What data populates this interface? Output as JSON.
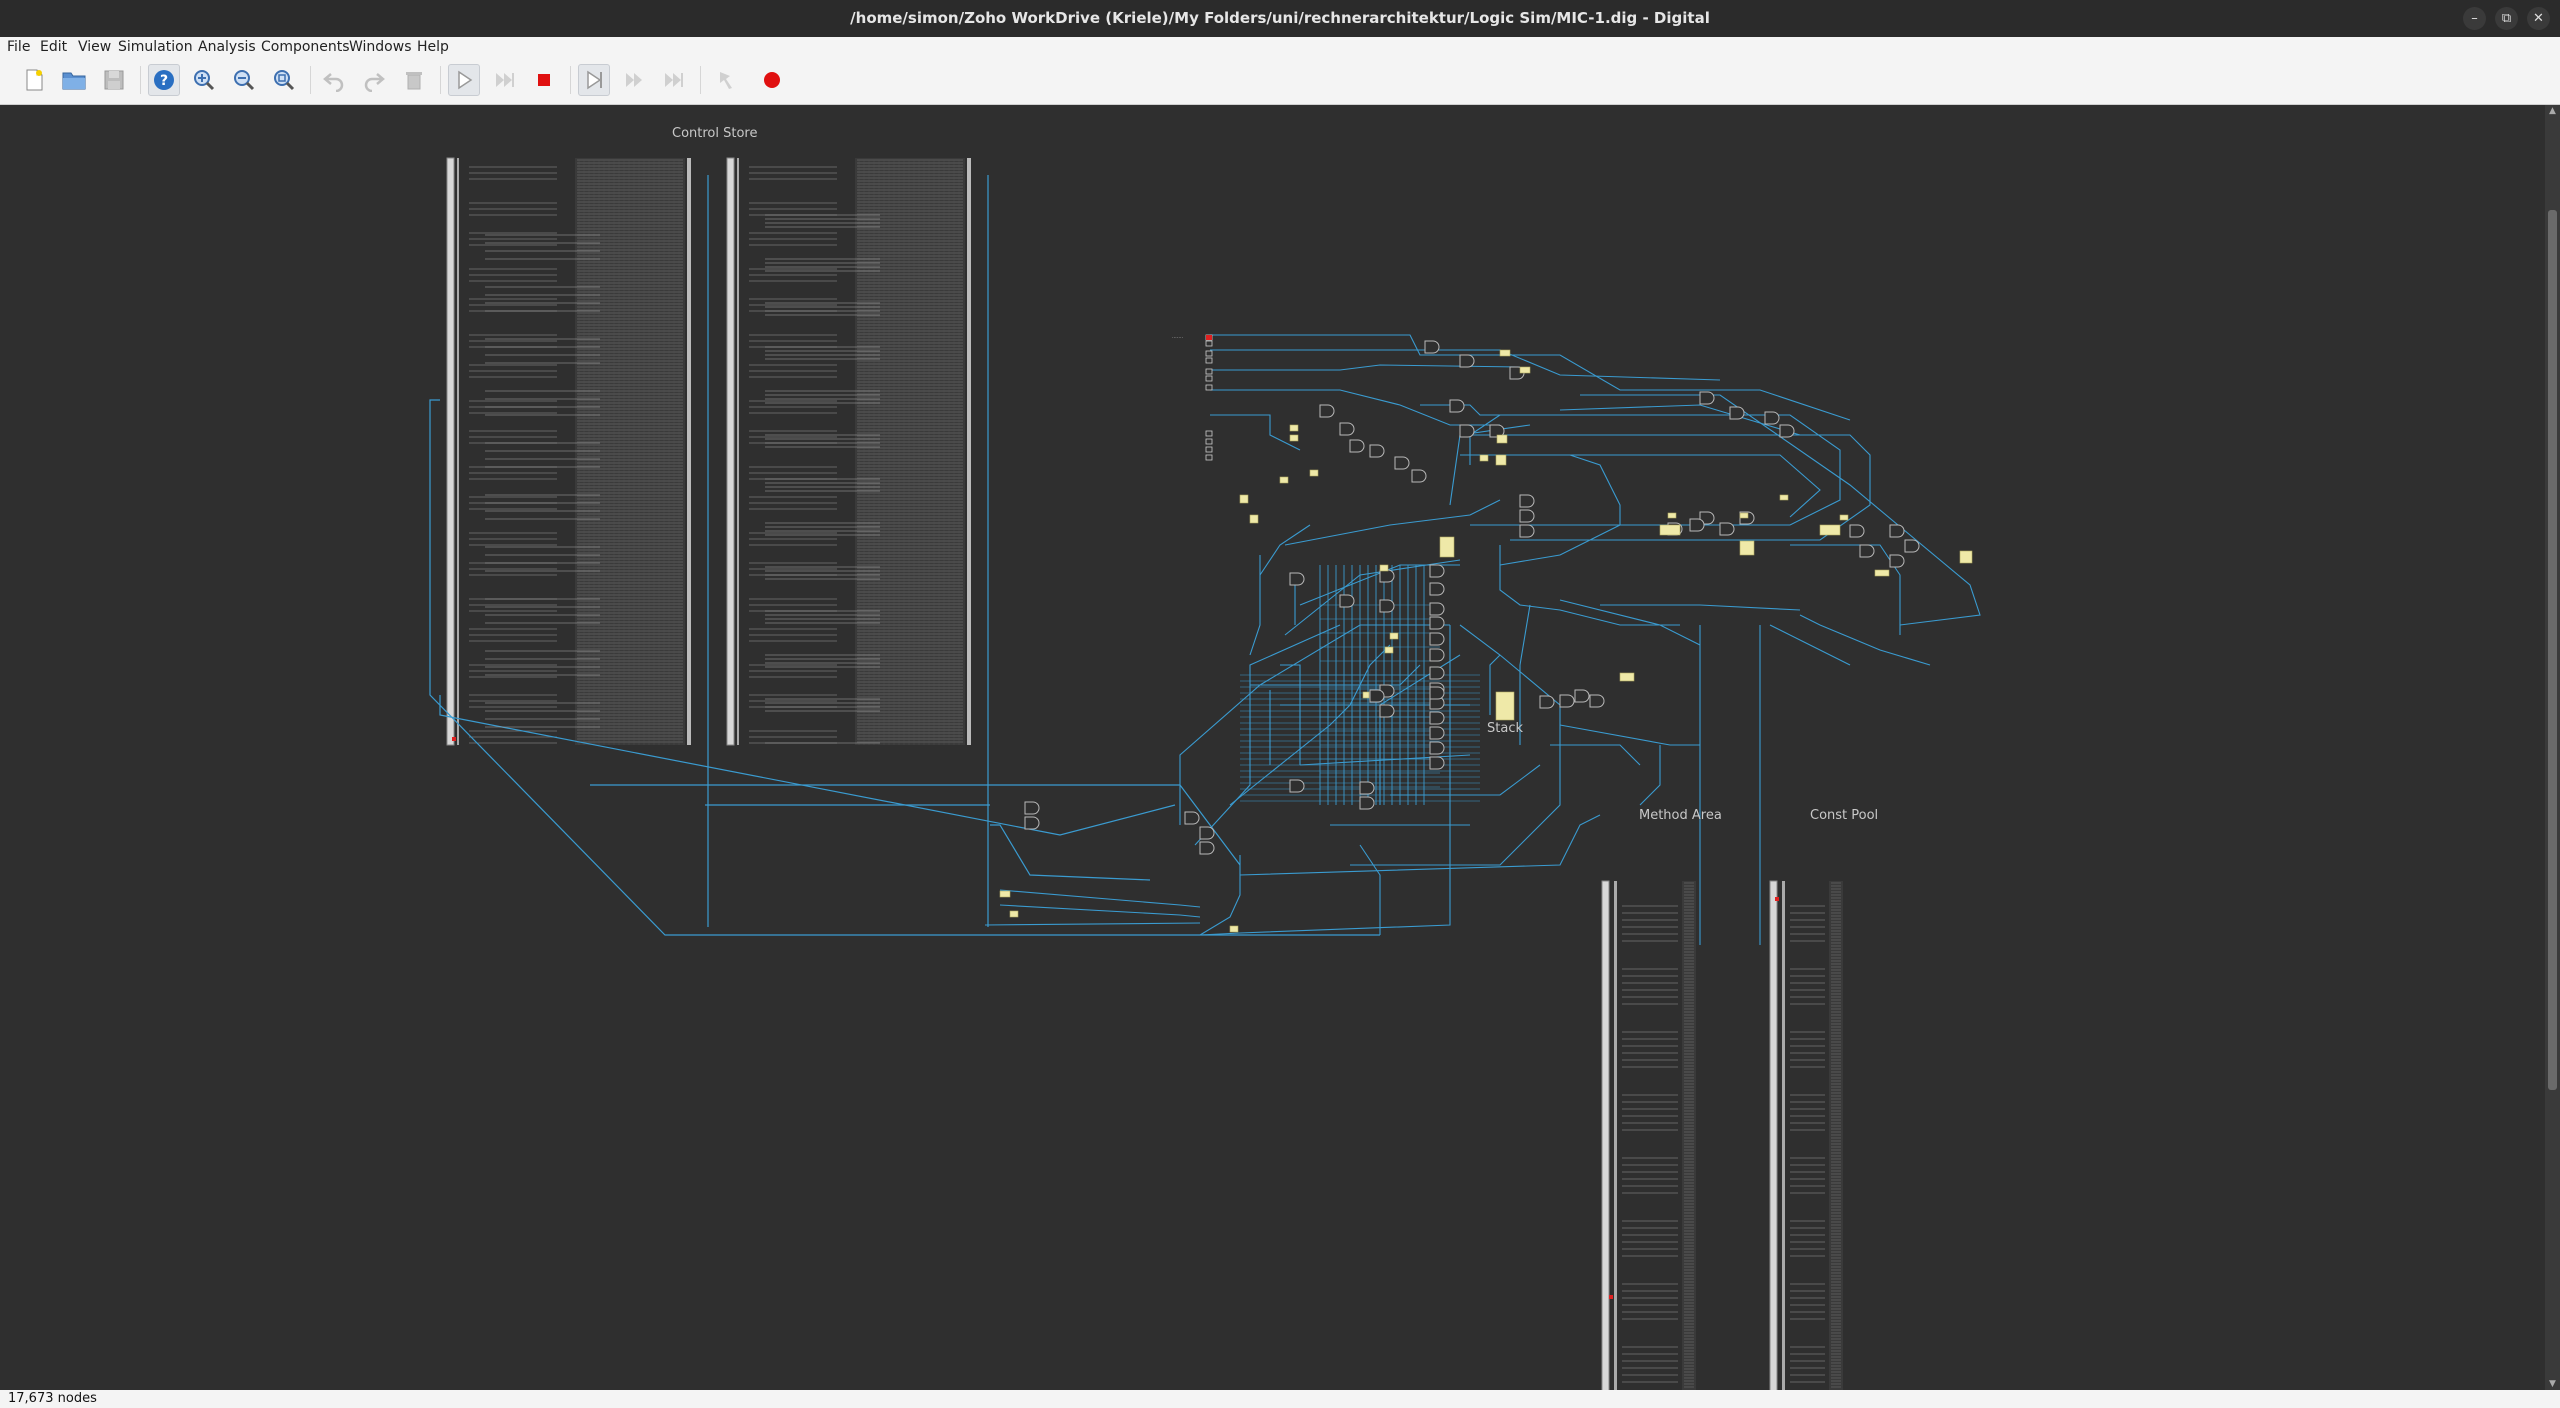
{
  "window": {
    "title": "/home/simon/Zoho WorkDrive (Kriele)/My Folders/uni/rechnerarchitektur/Logic Sim/MIC-1.dig - Digital",
    "controls": [
      "minimize-icon",
      "restore-icon",
      "close-icon"
    ]
  },
  "menu": [
    "File",
    "Edit",
    "View",
    "Simulation",
    "Analysis",
    "Components",
    "Windows",
    "Help"
  ],
  "toolbar": {
    "buttons": [
      {
        "name": "new-file-icon",
        "enabled": true
      },
      {
        "name": "open-folder-icon",
        "enabled": true
      },
      {
        "name": "save-icon",
        "enabled": false
      },
      {
        "name": "help-icon",
        "enabled": true
      },
      {
        "name": "zoom-in-icon",
        "enabled": true
      },
      {
        "name": "zoom-out-icon",
        "enabled": true
      },
      {
        "name": "zoom-fit-icon",
        "enabled": true
      },
      {
        "name": "undo-icon",
        "enabled": false
      },
      {
        "name": "redo-icon",
        "enabled": false
      },
      {
        "name": "delete-icon",
        "enabled": false
      },
      {
        "name": "start-simulation-icon",
        "enabled": true
      },
      {
        "name": "fast-run-icon",
        "enabled": false
      },
      {
        "name": "stop-simulation-icon",
        "enabled": true
      },
      {
        "name": "single-step-icon",
        "enabled": true
      },
      {
        "name": "run-to-break-icon",
        "enabled": false
      },
      {
        "name": "run-to-end-icon",
        "enabled": false
      },
      {
        "name": "analysis-icon",
        "enabled": false
      },
      {
        "name": "record-icon",
        "enabled": true
      }
    ],
    "colors": {
      "stop": "#e01010",
      "record": "#e01010",
      "help": "#2a6fc2"
    }
  },
  "canvas": {
    "labels": {
      "control_store": "Control Store",
      "stack": "Stack",
      "method_area": "Method Area",
      "const_pool": "Const Pool"
    },
    "colors": {
      "background": "#2f2f2f",
      "wire": "#3a9bd0",
      "component": "#b8b8b8",
      "register": "#efe9a8",
      "high_signal": "#e02020"
    }
  },
  "status": {
    "nodes": "17,673 nodes"
  }
}
